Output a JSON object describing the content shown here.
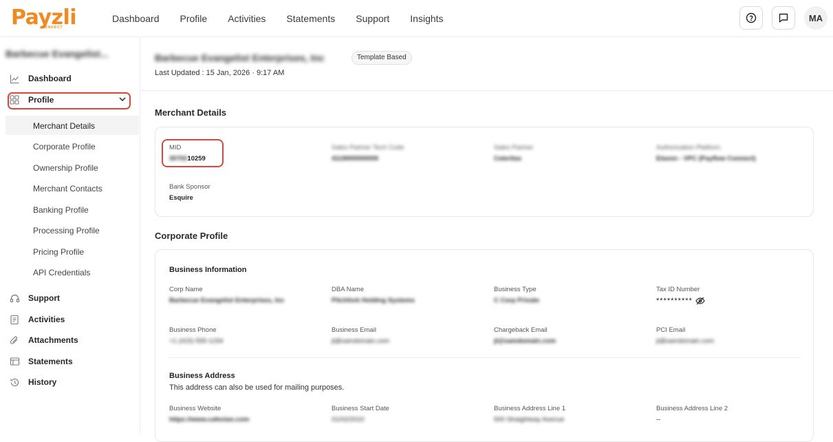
{
  "brand": {
    "logo": "Payzli",
    "sub": "CONNECT"
  },
  "nav": [
    "Dashboard",
    "Profile",
    "Activities",
    "Statements",
    "Support",
    "Insights"
  ],
  "user": {
    "initials": "MA"
  },
  "sidebar": {
    "merchant_name": "Barbecue Evangelist...",
    "items": {
      "dashboard": "Dashboard",
      "profile": "Profile",
      "support": "Support",
      "activities": "Activities",
      "attachments": "Attachments",
      "statements": "Statements",
      "history": "History"
    },
    "profile_sub": [
      "Merchant Details",
      "Corporate Profile",
      "Ownership Profile",
      "Merchant Contacts",
      "Banking Profile",
      "Processing Profile",
      "Pricing Profile",
      "API Credentials"
    ]
  },
  "header": {
    "title": "Barbecue Evangelist Enterprises, Inc",
    "badge": "Template Based",
    "last_updated_label": "Last Updated :",
    "last_updated_value": "15 Jan, 2026 · 9:17 AM"
  },
  "merchant_details": {
    "title": "Merchant Details",
    "mid_label": "MID",
    "mid_hidden": "30702",
    "mid_visible": "10259",
    "col2_label": "Sales Partner Tech Code",
    "col2_value": "4119000000000",
    "col3_label": "Sales Partner",
    "col3_value": "Celeritas",
    "col4_label": "Authorization Platform",
    "col4_value": "Elavon - VPC (Payflow Connect)",
    "bank_sponsor_label": "Bank Sponsor",
    "bank_sponsor_value": "Esquire"
  },
  "corporate_profile": {
    "title": "Corporate Profile",
    "business_info": "Business Information",
    "corp_name_label": "Corp Name",
    "corp_name_value": "Barbecue Evangelist Enterprises, Inc",
    "dba_label": "DBA Name",
    "dba_value": "Pitchfork Holding Systems",
    "business_type_label": "Business Type",
    "business_type_value": "C Corp Private",
    "tax_id_label": "Tax ID Number",
    "tax_id_value": "**********",
    "phone_label": "Business Phone",
    "phone_value": "+1 (415) 555-1234",
    "email_label": "Business Email",
    "email_value": "jt@samdomain.com",
    "chargeback_label": "Chargeback Email",
    "chargeback_value": "jt@samdomain.com",
    "pci_label": "PCI Email",
    "pci_value": "jt@samdomain.com",
    "address_title": "Business Address",
    "address_note": "This address can also be used for mailing purposes.",
    "website_label": "Business Website",
    "website_value": "https://www.cafexian.com",
    "start_date_label": "Business Start Date",
    "start_date_value": "01/02/2010",
    "addr1_label": "Business Address Line 1",
    "addr1_value": "500 Straightway Avenue",
    "addr2_label": "Business Address Line 2",
    "addr2_value": "--"
  }
}
